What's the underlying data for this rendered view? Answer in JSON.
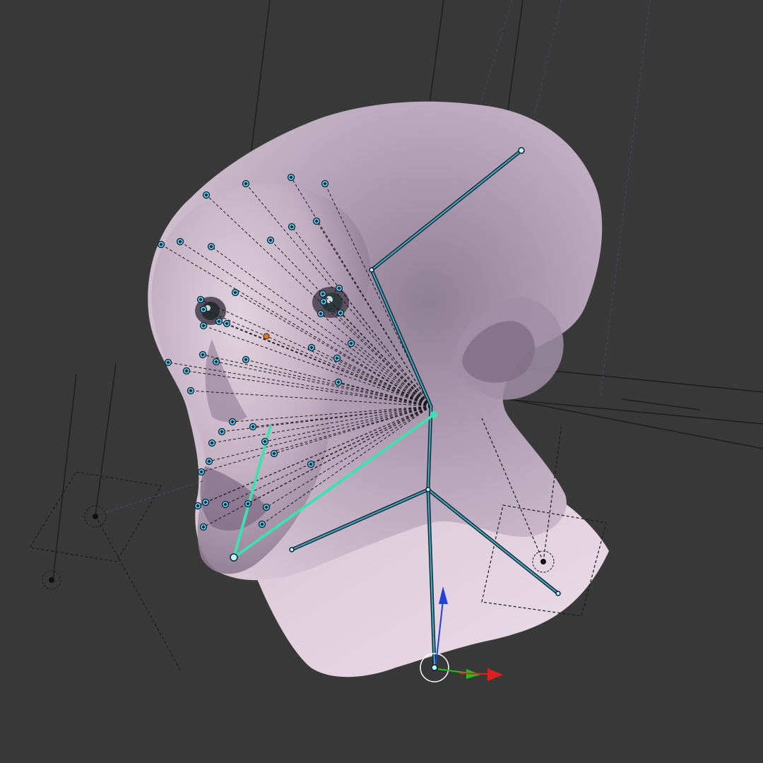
{
  "viewport": {
    "background": "#393939",
    "head_color": "#b9a4bb",
    "bone_color": "#2a5a6a",
    "active_bone_color": "#3fe0b0",
    "marker_color": "#5fc8ec",
    "origin_color": "#e07a20"
  },
  "icons": {
    "gizmo": "transform-manipulator-icon",
    "empty": "empty-object-icon",
    "origin": "object-origin-icon"
  },
  "axes": {
    "x_color": "#e02020",
    "y_color": "#20c020",
    "z_color": "#2040e0"
  }
}
